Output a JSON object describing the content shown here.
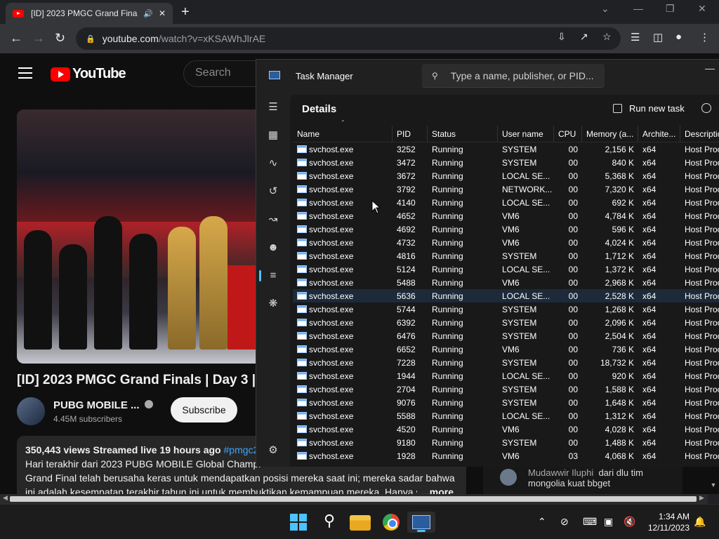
{
  "browser": {
    "tab_title": "[ID] 2023 PMGC Grand Finals",
    "tab_audio_icon": "speaker-icon",
    "url_host": "youtube.com",
    "url_path": "/watch?v=xKSAWhJlrAE"
  },
  "youtube": {
    "logo_text": "YouTube",
    "search_placeholder": "Search",
    "video_title": "[ID] 2023 PMGC Grand Finals | Day 3 | PU",
    "channel_name": "PUBG MOBILE ...",
    "subscribers": "4.45M subscribers",
    "subscribe_label": "Subscribe",
    "views": "350,443 views",
    "streamed": "Streamed live 19 hours ago",
    "hashtag": "#pmgc2",
    "description_line1": "Hari terakhir dari 2023 PUBG MOBILE Global Champi",
    "description_line2": "Grand Final telah berusaha keras untuk mendapatkan posisi mereka saat ini; mereka sadar bahwa",
    "description_line3": "ini adalah kesempatan terakhir tahun ini untuk membuktikan kemampuan mereka. Hanya s",
    "more_label": "...more",
    "chat_user": "Mudawwir Iluphi",
    "chat_text1": "dari dlu tim",
    "chat_text2": "mongolia kuat bbget"
  },
  "task_manager": {
    "title": "Task Manager",
    "search_placeholder": "Type a name, publisher, or PID...",
    "page_title": "Details",
    "run_new_task": "Run new task",
    "nav_icons": [
      "hamburger-icon",
      "processes-icon",
      "performance-icon",
      "app-history-icon",
      "startup-icon",
      "users-icon",
      "details-icon",
      "services-icon",
      "settings-icon"
    ],
    "columns": [
      "Name",
      "PID",
      "Status",
      "User name",
      "CPU",
      "Memory (a...",
      "Archite...",
      "Descriptio"
    ],
    "rows": [
      [
        "svchost.exe",
        "3252",
        "Running",
        "SYSTEM",
        "00",
        "2,156 K",
        "x64",
        "Host Proc"
      ],
      [
        "svchost.exe",
        "3472",
        "Running",
        "SYSTEM",
        "00",
        "840 K",
        "x64",
        "Host Proc"
      ],
      [
        "svchost.exe",
        "3672",
        "Running",
        "LOCAL SE...",
        "00",
        "5,368 K",
        "x64",
        "Host Proc"
      ],
      [
        "svchost.exe",
        "3792",
        "Running",
        "NETWORK...",
        "00",
        "7,320 K",
        "x64",
        "Host Proc"
      ],
      [
        "svchost.exe",
        "4140",
        "Running",
        "LOCAL SE...",
        "00",
        "692 K",
        "x64",
        "Host Proc"
      ],
      [
        "svchost.exe",
        "4652",
        "Running",
        "VM6",
        "00",
        "4,784 K",
        "x64",
        "Host Proc"
      ],
      [
        "svchost.exe",
        "4692",
        "Running",
        "VM6",
        "00",
        "596 K",
        "x64",
        "Host Proc"
      ],
      [
        "svchost.exe",
        "4732",
        "Running",
        "VM6",
        "00",
        "4,024 K",
        "x64",
        "Host Proc"
      ],
      [
        "svchost.exe",
        "4816",
        "Running",
        "SYSTEM",
        "00",
        "1,712 K",
        "x64",
        "Host Proc"
      ],
      [
        "svchost.exe",
        "5124",
        "Running",
        "LOCAL SE...",
        "00",
        "1,372 K",
        "x64",
        "Host Proc"
      ],
      [
        "svchost.exe",
        "5488",
        "Running",
        "VM6",
        "00",
        "2,968 K",
        "x64",
        "Host Proc"
      ],
      [
        "svchost.exe",
        "5636",
        "Running",
        "LOCAL SE...",
        "00",
        "2,528 K",
        "x64",
        "Host Proc"
      ],
      [
        "svchost.exe",
        "5744",
        "Running",
        "SYSTEM",
        "00",
        "1,268 K",
        "x64",
        "Host Proc"
      ],
      [
        "svchost.exe",
        "6392",
        "Running",
        "SYSTEM",
        "00",
        "2,096 K",
        "x64",
        "Host Proc"
      ],
      [
        "svchost.exe",
        "6476",
        "Running",
        "SYSTEM",
        "00",
        "2,504 K",
        "x64",
        "Host Proc"
      ],
      [
        "svchost.exe",
        "6652",
        "Running",
        "VM6",
        "00",
        "736 K",
        "x64",
        "Host Proc"
      ],
      [
        "svchost.exe",
        "7228",
        "Running",
        "SYSTEM",
        "00",
        "18,732 K",
        "x64",
        "Host Proc"
      ],
      [
        "svchost.exe",
        "1944",
        "Running",
        "LOCAL SE...",
        "00",
        "920 K",
        "x64",
        "Host Proc"
      ],
      [
        "svchost.exe",
        "2704",
        "Running",
        "SYSTEM",
        "00",
        "1,588 K",
        "x64",
        "Host Proc"
      ],
      [
        "svchost.exe",
        "9076",
        "Running",
        "SYSTEM",
        "00",
        "1,648 K",
        "x64",
        "Host Proc"
      ],
      [
        "svchost.exe",
        "5588",
        "Running",
        "LOCAL SE...",
        "00",
        "1,312 K",
        "x64",
        "Host Proc"
      ],
      [
        "svchost.exe",
        "4520",
        "Running",
        "VM6",
        "00",
        "4,028 K",
        "x64",
        "Host Proc"
      ],
      [
        "svchost.exe",
        "9180",
        "Running",
        "SYSTEM",
        "00",
        "1,488 K",
        "x64",
        "Host Proc"
      ],
      [
        "svchost.exe",
        "1928",
        "Running",
        "VM6",
        "03",
        "4,068 K",
        "x64",
        "Host Proc"
      ]
    ],
    "selected_row_index": 11
  },
  "taskbar": {
    "time": "1:34 AM",
    "date": "12/11/2023"
  },
  "colors": {
    "accent": "#4cc2ff",
    "youtube_red": "#ff0000",
    "selected_row": "#1c2a3a"
  }
}
